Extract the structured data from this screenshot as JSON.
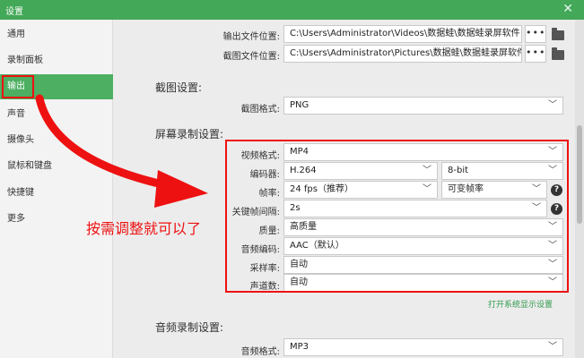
{
  "window": {
    "title": "设置",
    "close_glyph": "✕"
  },
  "sidebar": {
    "items": [
      {
        "label": "通用"
      },
      {
        "label": "录制面板"
      },
      {
        "label": "输出",
        "active": true
      },
      {
        "label": "声音"
      },
      {
        "label": "摄像头"
      },
      {
        "label": "鼠标和键盘"
      },
      {
        "label": "快捷键"
      },
      {
        "label": "更多"
      }
    ]
  },
  "paths": {
    "output_label": "输出文件位置:",
    "output_value": "C:\\Users\\Administrator\\Videos\\数据蛙\\数据蛙录屏软件",
    "screenshot_label": "截图文件位置:",
    "screenshot_value": "C:\\Users\\Administrator\\Pictures\\数据蛙\\数据蛙录屏软件",
    "dots": "•••"
  },
  "screenshot": {
    "section_title": "截图设置:",
    "format_label": "截图格式:",
    "format_value": "PNG"
  },
  "screen_record": {
    "section_title": "屏幕录制设置:",
    "video_format_label": "视频格式:",
    "video_format_value": "MP4",
    "encoder_label": "编码器:",
    "encoder_value": "H.264",
    "bitdepth_value": "8-bit",
    "framerate_label": "帧率:",
    "framerate_value": "24 fps（推荐）",
    "framerate_mode_value": "可变帧率",
    "keyframe_label": "关键帧间隔:",
    "keyframe_value": "2s",
    "quality_label": "质量:",
    "quality_value": "高质量",
    "audio_codec_label": "音频编码:",
    "audio_codec_value": "AAC（默认）",
    "samplerate_label": "采样率:",
    "samplerate_value": "自动",
    "channels_label": "声道数:",
    "channels_value": "自动",
    "system_display_link": "打开系统显示设置"
  },
  "audio_record": {
    "section_title": "音频录制设置:",
    "format_label": "音频格式:",
    "format_value": "MP3"
  },
  "annotation": {
    "text": "按需调整就可以了"
  },
  "colors": {
    "accent": "#43a857",
    "annotation_red": "#e11111",
    "link": "#2e9a4a"
  }
}
